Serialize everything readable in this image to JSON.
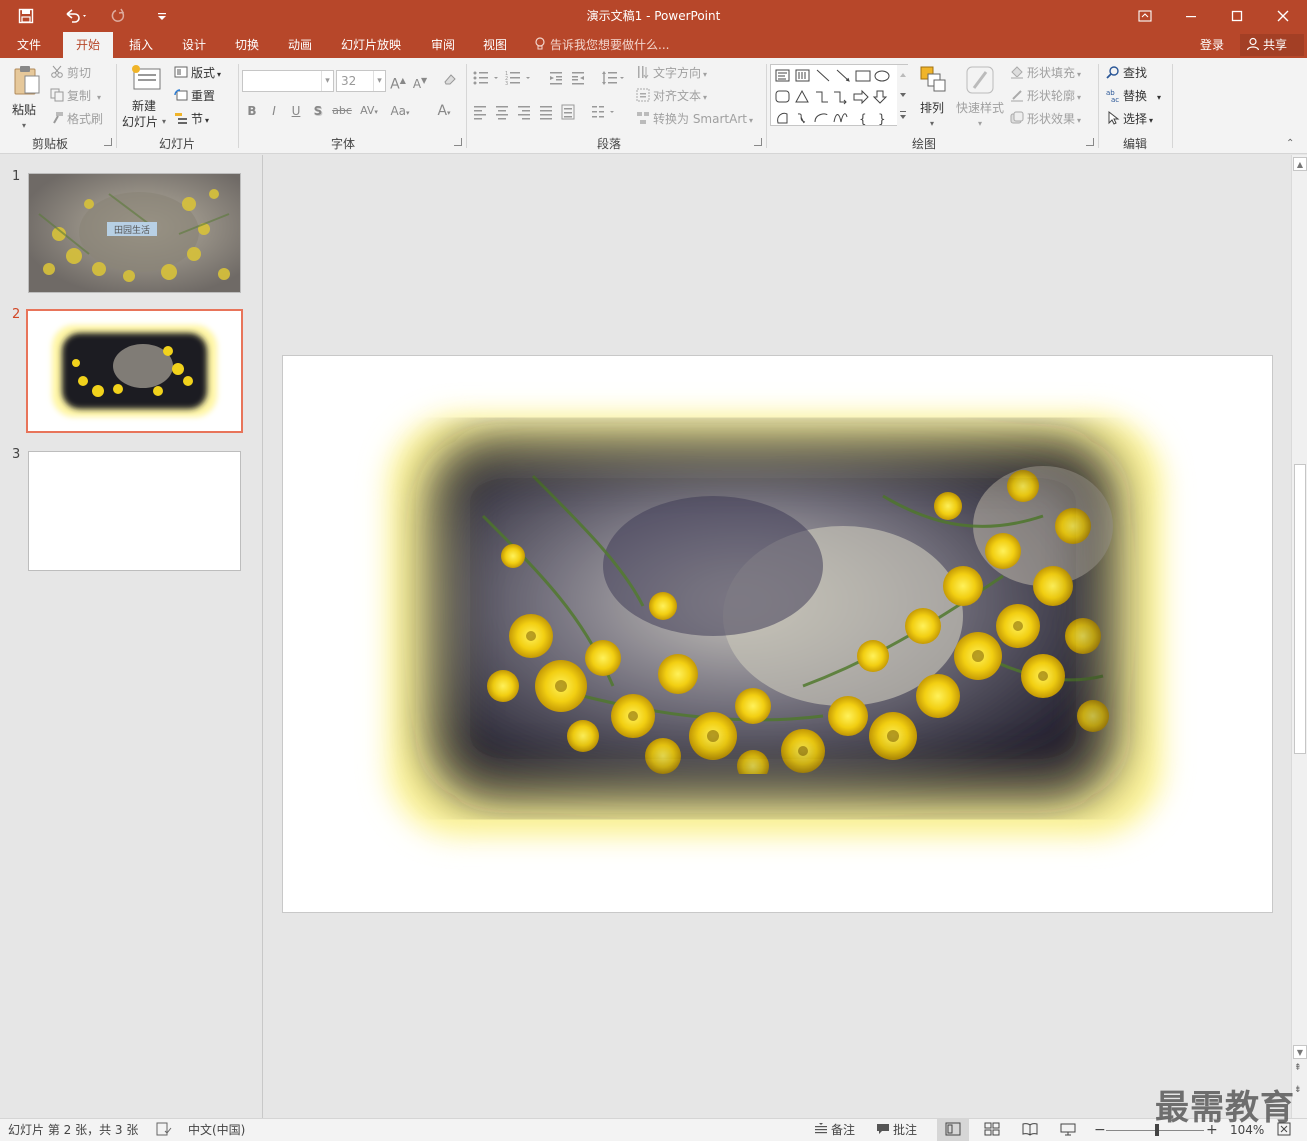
{
  "window": {
    "title": "演示文稿1 - PowerPoint",
    "accent": "#b7472a"
  },
  "quick_access": {
    "save_icon": "save-icon",
    "undo_icon": "undo-icon",
    "redo_icon": "redo-icon",
    "customize_icon": "customize-qat-icon"
  },
  "tabs": [
    {
      "label": "文件",
      "active": false
    },
    {
      "label": "开始",
      "active": true
    },
    {
      "label": "插入",
      "active": false
    },
    {
      "label": "设计",
      "active": false
    },
    {
      "label": "切换",
      "active": false
    },
    {
      "label": "动画",
      "active": false
    },
    {
      "label": "幻灯片放映",
      "active": false
    },
    {
      "label": "审阅",
      "active": false
    },
    {
      "label": "视图",
      "active": false
    }
  ],
  "tell_me": "告诉我您想要做什么...",
  "account": {
    "login": "登录",
    "share": "共享"
  },
  "ribbon": {
    "clipboard": {
      "group": "剪贴板",
      "paste": "粘贴",
      "cut": "剪切",
      "copy": "复制",
      "format_painter": "格式刷"
    },
    "slides": {
      "group": "幻灯片",
      "new_slide_line1": "新建",
      "new_slide_line2": "幻灯片",
      "layout": "版式",
      "reset": "重置",
      "section": "节"
    },
    "font": {
      "group": "字体",
      "font_name": "",
      "font_size": "32",
      "bold": "B",
      "italic": "I",
      "underline": "U",
      "shadow": "S",
      "strikethrough": "abc",
      "spacing": "AV",
      "case": "Aa",
      "color": "A",
      "grow": "A",
      "shrink": "A"
    },
    "paragraph": {
      "group": "段落",
      "text_direction": "文字方向",
      "align_text": "对齐文本",
      "smartart": "转换为 SmartArt"
    },
    "drawing": {
      "group": "绘图",
      "arrange": "排列",
      "quick_styles": "快速样式",
      "shape_fill": "形状填充",
      "shape_outline": "形状轮廓",
      "shape_effects": "形状效果"
    },
    "editing": {
      "group": "编辑",
      "find": "查找",
      "replace": "替换",
      "select": "选择"
    }
  },
  "thumbnails": [
    {
      "number": "1",
      "caption": "田园生活",
      "selected": false
    },
    {
      "number": "2",
      "caption": "",
      "selected": true
    },
    {
      "number": "3",
      "caption": "",
      "selected": false
    }
  ],
  "status": {
    "slide_info": "幻灯片 第 2 张，共 3 张",
    "language": "中文(中国)",
    "notes": "备注",
    "comments": "批注",
    "zoom": "104%",
    "zoom_level": 0.52
  },
  "watermark": "最需教育"
}
